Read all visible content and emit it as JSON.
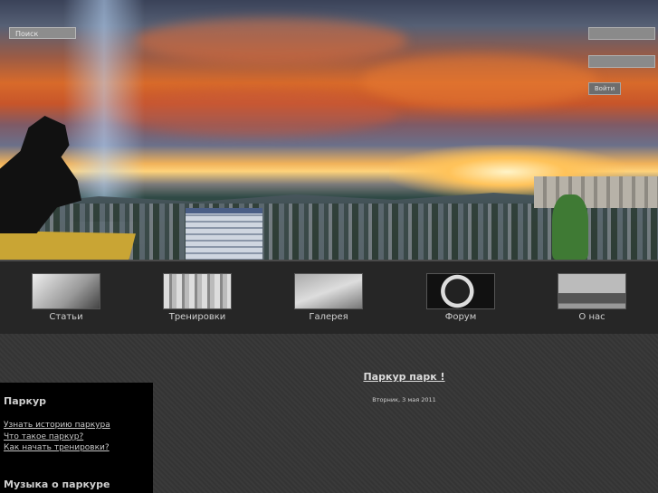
{
  "header": {
    "search_placeholder": "Поиск",
    "login_button": "Войти"
  },
  "nav": {
    "items": [
      {
        "label": "Статьи",
        "icon": "articles-thumbnail"
      },
      {
        "label": "Тренировки",
        "icon": "training-thumbnail"
      },
      {
        "label": "Галерея",
        "icon": "gallery-thumbnail"
      },
      {
        "label": "Форум",
        "icon": "forum-thumbnail"
      },
      {
        "label": "О нас",
        "icon": "about-thumbnail"
      }
    ]
  },
  "sidebar": {
    "section1_title": "Паркур",
    "links": [
      "Узнать историю паркура",
      "Что такое паркур?",
      "Как начать тренировки?"
    ],
    "section2_title": "Музыка о паркуре"
  },
  "article": {
    "title": "Паркур парк !",
    "date": "Вторник, 3 мая 2011"
  },
  "colors": {
    "background": "#333333",
    "navbar": "#262626",
    "sidebar": "#000000"
  }
}
